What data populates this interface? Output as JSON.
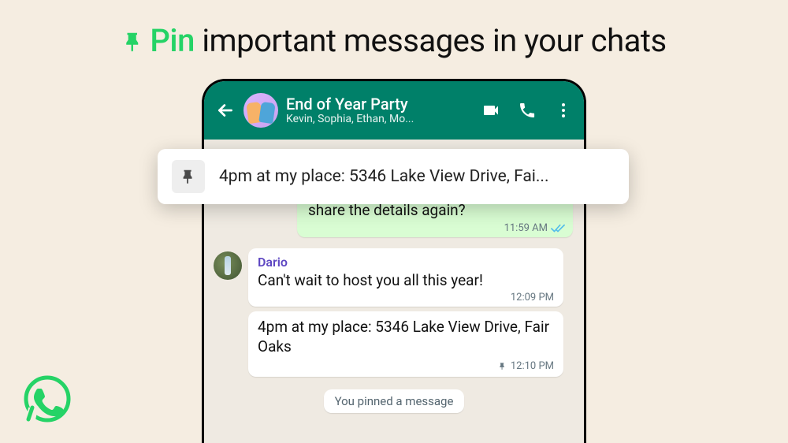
{
  "title": {
    "pin_word": "Pin",
    "rest": " important messages in your chats"
  },
  "chat": {
    "header": {
      "title": "End of Year Party",
      "subtitle": "Kevin, Sophia, Ethan, Mo..."
    },
    "pinned_banner": "4pm at my place: 5346 Lake View Drive, Fai...",
    "outgoing": {
      "text": "share the details again?",
      "time": "11:59 AM"
    },
    "incoming": {
      "sender": "Dario",
      "msg1": {
        "text": "Can't wait to host you all this year!",
        "time": "12:09 PM"
      },
      "msg2": {
        "text": "4pm at my place: 5346 Lake View Drive, Fair Oaks",
        "time": "12:10 PM"
      }
    },
    "system": "You pinned a message"
  },
  "colors": {
    "accent_green": "#25d366",
    "header_green": "#008069",
    "bubble_out": "#d9fdd3",
    "read_check": "#53bdeb"
  }
}
